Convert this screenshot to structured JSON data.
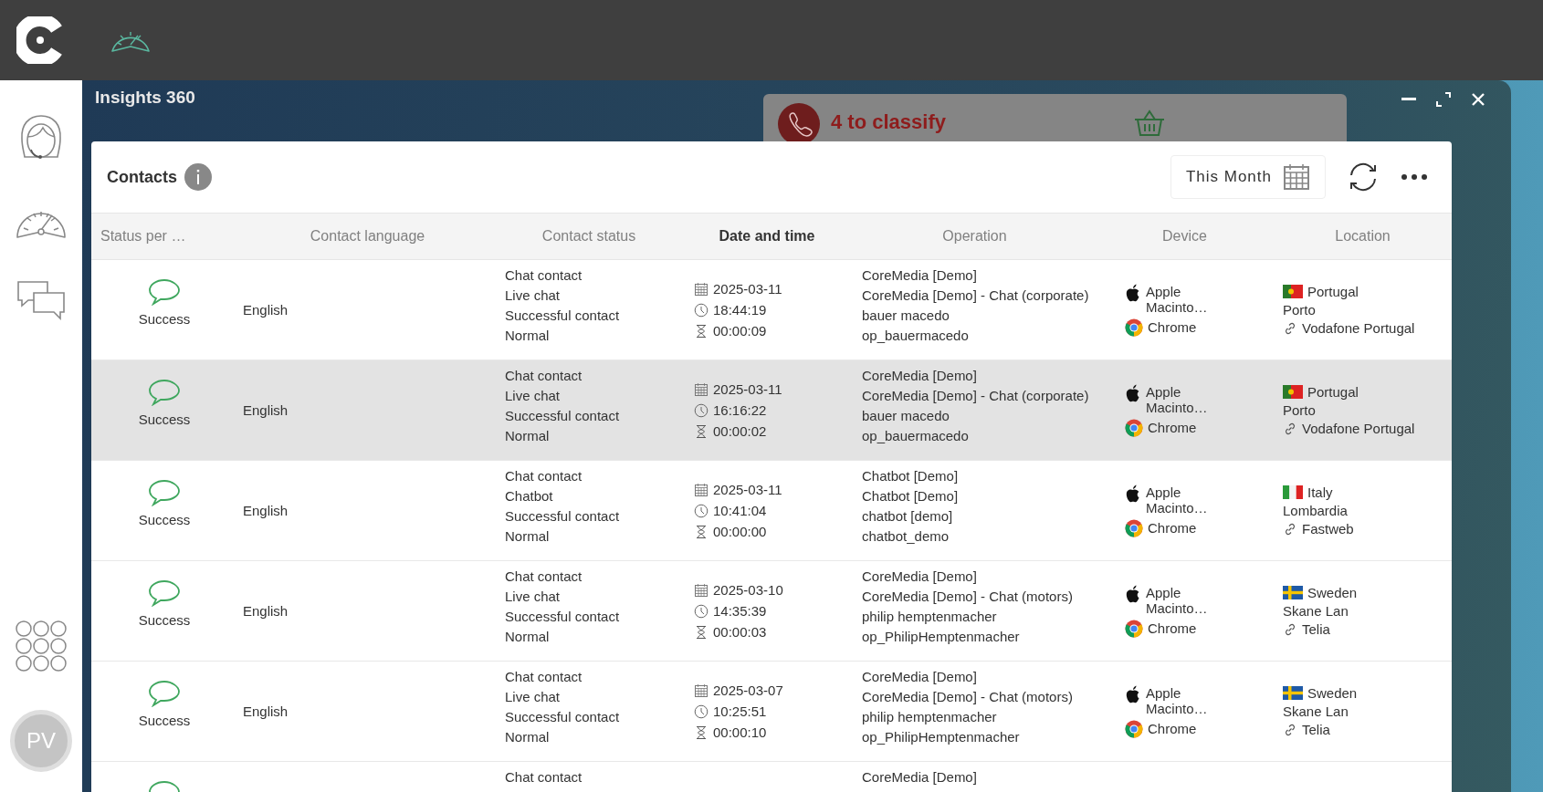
{
  "sidebar": {
    "avatar": "PV"
  },
  "window": {
    "title": "Insights 360"
  },
  "notification": {
    "text": "4 to classify"
  },
  "panel": {
    "title": "Contacts",
    "period": "This Month"
  },
  "table": {
    "columns": [
      {
        "label": "Status per …",
        "sorted": false
      },
      {
        "label": "Contact language",
        "sorted": false
      },
      {
        "label": "Contact status",
        "sorted": false
      },
      {
        "label": "Date and time",
        "sorted": true
      },
      {
        "label": "Operation",
        "sorted": false
      },
      {
        "label": "Device",
        "sorted": false
      },
      {
        "label": "Location",
        "sorted": false
      }
    ],
    "rows": [
      {
        "highlighted": false,
        "status": {
          "kind": "chat",
          "label": "Success"
        },
        "language": "English",
        "contact_status": [
          "Chat contact",
          "Live chat",
          "Successful contact",
          "Normal"
        ],
        "date": "2025-03-11",
        "time": "18:44:19",
        "duration": "00:00:09",
        "operation": [
          "CoreMedia [Demo]",
          "CoreMedia [Demo] - Chat (corporate)",
          "bauer macedo",
          "op_bauermacedo"
        ],
        "os": "Apple Macinto…",
        "browser": "Chrome",
        "country": "Portugal",
        "kind": "portugal",
        "region": "Porto",
        "isp": "Vodafone Portugal"
      },
      {
        "highlighted": true,
        "status": {
          "kind": "chat",
          "label": "Success"
        },
        "language": "English",
        "contact_status": [
          "Chat contact",
          "Live chat",
          "Successful contact",
          "Normal"
        ],
        "date": "2025-03-11",
        "time": "16:16:22",
        "duration": "00:00:02",
        "operation": [
          "CoreMedia [Demo]",
          "CoreMedia [Demo] - Chat (corporate)",
          "bauer macedo",
          "op_bauermacedo"
        ],
        "os": "Apple Macinto…",
        "browser": "Chrome",
        "country": "Portugal",
        "kind": "portugal",
        "region": "Porto",
        "isp": "Vodafone Portugal"
      },
      {
        "highlighted": false,
        "status": {
          "kind": "chat",
          "label": "Success"
        },
        "language": "English",
        "contact_status": [
          "Chat contact",
          "Chatbot",
          "Successful contact",
          "Normal"
        ],
        "date": "2025-03-11",
        "time": "10:41:04",
        "duration": "00:00:00",
        "operation": [
          "Chatbot [Demo]",
          "Chatbot [Demo]",
          "chatbot [demo]",
          "chatbot_demo"
        ],
        "os": "Apple Macinto…",
        "browser": "Chrome",
        "country": "Italy",
        "kind": "italy",
        "region": "Lombardia",
        "isp": "Fastweb"
      },
      {
        "highlighted": false,
        "status": {
          "kind": "chat",
          "label": "Success"
        },
        "language": "English",
        "contact_status": [
          "Chat contact",
          "Live chat",
          "Successful contact",
          "Normal"
        ],
        "date": "2025-03-10",
        "time": "14:35:39",
        "duration": "00:00:03",
        "operation": [
          "CoreMedia [Demo]",
          "CoreMedia [Demo] - Chat (motors)",
          "philip hemptenmacher",
          "op_PhilipHemptenmacher"
        ],
        "os": "Apple Macinto…",
        "browser": "Chrome",
        "country": "Sweden",
        "kind": "sweden",
        "region": "Skane Lan",
        "isp": "Telia"
      },
      {
        "highlighted": false,
        "status": {
          "kind": "chat",
          "label": "Success"
        },
        "language": "English",
        "contact_status": [
          "Chat contact",
          "Live chat",
          "Successful contact",
          "Normal"
        ],
        "date": "2025-03-07",
        "time": "10:25:51",
        "duration": "00:00:10",
        "operation": [
          "CoreMedia [Demo]",
          "CoreMedia [Demo] - Chat (motors)",
          "philip hemptenmacher",
          "op_PhilipHemptenmacher"
        ],
        "os": "Apple Macinto…",
        "browser": "Chrome",
        "country": "Sweden",
        "kind": "sweden",
        "region": "Skane Lan",
        "isp": "Telia"
      },
      {
        "highlighted": false,
        "status": {
          "kind": "chat"
        },
        "contact_status": [
          "Chat contact"
        ],
        "operation": [
          "CoreMedia [Demo]"
        ]
      }
    ]
  }
}
